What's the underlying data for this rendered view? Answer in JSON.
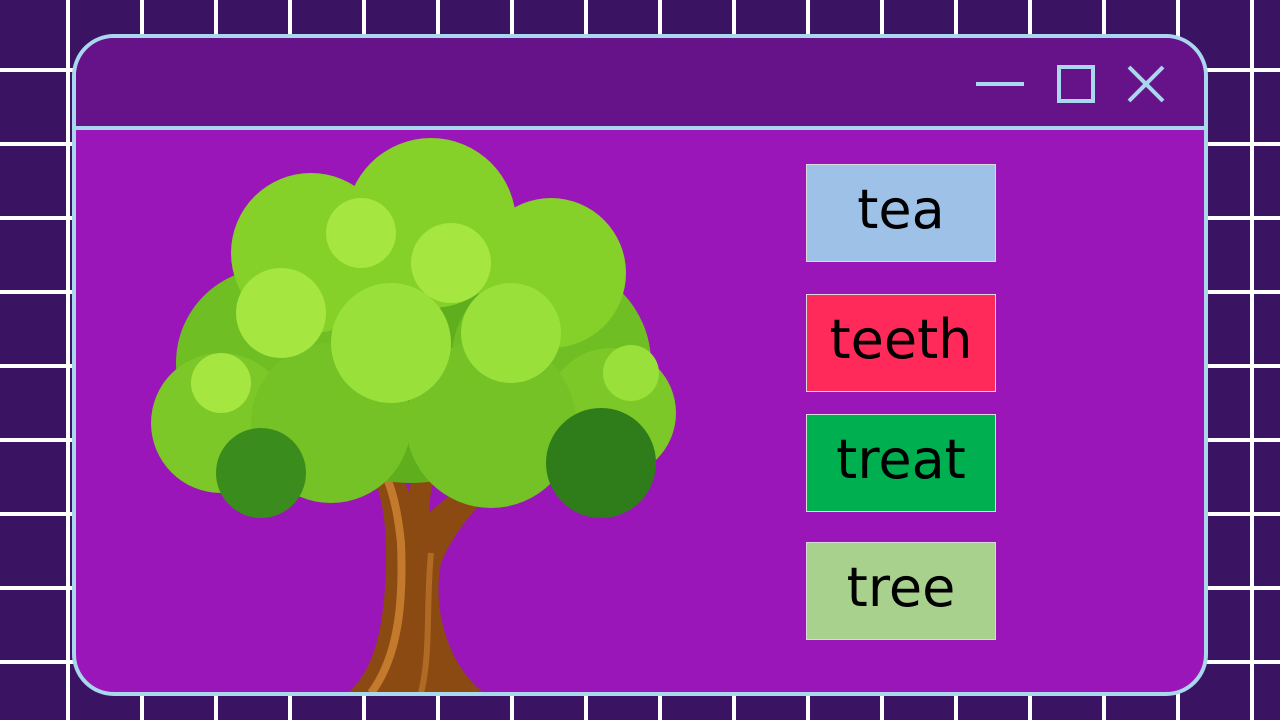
{
  "window": {
    "controls": {
      "minimize_icon": "minimize-icon",
      "maximize_icon": "maximize-icon",
      "close_icon": "close-icon"
    }
  },
  "illustration": {
    "subject": "tree"
  },
  "word_options": [
    {
      "label": "tea",
      "color": "#9ec1e8"
    },
    {
      "label": "teeth",
      "color": "#ff2a5a"
    },
    {
      "label": "treat",
      "color": "#00b050"
    },
    {
      "label": "tree",
      "color": "#a9d18e"
    }
  ],
  "colors": {
    "background": "#3a1463",
    "grid_lines": "#ffffff",
    "window_body": "#9b16b8",
    "window_titlebar": "#661288",
    "window_border": "#a9d8ee"
  }
}
